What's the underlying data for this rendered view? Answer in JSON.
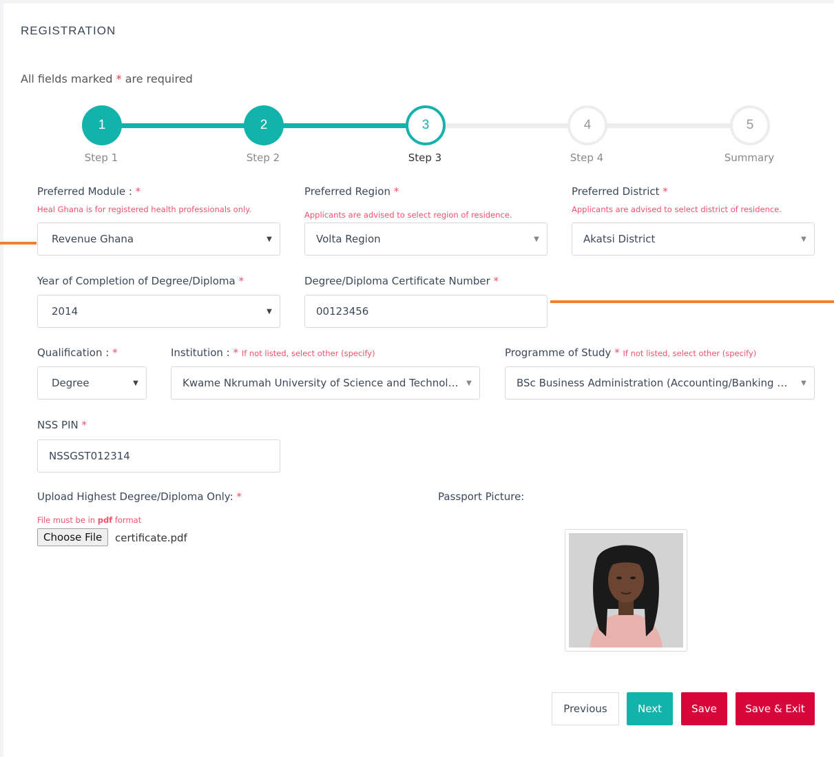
{
  "form": {
    "title": "REGISTRATION",
    "required_prefix": "All fields marked",
    "required_star": "*",
    "required_suffix": "are required"
  },
  "steps": [
    {
      "number": "1",
      "label": "Step 1",
      "state": "done"
    },
    {
      "number": "2",
      "label": "Step 2",
      "state": "done"
    },
    {
      "number": "3",
      "label": "Step 3",
      "state": "active"
    },
    {
      "number": "4",
      "label": "Step 4",
      "state": "todo"
    },
    {
      "number": "5",
      "label": "Summary",
      "state": "todo"
    }
  ],
  "fields": {
    "module": {
      "label": "Preferred Module :",
      "hint": "Heal Ghana is for registered health professionals only.",
      "value": "Revenue Ghana"
    },
    "region": {
      "label": "Preferred Region",
      "hint": "Applicants are advised to select region of residence.",
      "value": "Volta Region"
    },
    "district": {
      "label": "Preferred District",
      "hint": "Applicants are advised to select district of residence.",
      "value": "Akatsi District"
    },
    "year": {
      "label": "Year of Completion of Degree/Diploma",
      "value": "2014"
    },
    "certificate": {
      "label": "Degree/Diploma Certificate Number",
      "value": "00123456"
    },
    "qualification": {
      "label": "Qualification :",
      "value": "Degree"
    },
    "institution": {
      "label": "Institution :",
      "hint": "If not listed, select other (specify)",
      "value": "Kwame Nkrumah University of Science and Technology"
    },
    "programme": {
      "label": "Programme of Study",
      "hint": "If not listed, select other (specify)",
      "value": "BSc Business Administration (Accounting/Banking & Finance)"
    },
    "nss_pin": {
      "label": "NSS PIN",
      "value": "NSSGST012314"
    },
    "upload": {
      "label": "Upload Highest Degree/Diploma Only:",
      "hint_prefix": "File must be in",
      "hint_bold": "pdf",
      "hint_suffix": "format",
      "button": "Choose File",
      "filename": "certificate.pdf"
    },
    "passport": {
      "label": "Passport Picture:"
    }
  },
  "buttons": {
    "previous": "Previous",
    "next": "Next",
    "save": "Save",
    "save_exit": "Save & Exit"
  },
  "colors": {
    "accent": "#13b2aa",
    "danger": "#d6063b",
    "required": "#f0506e",
    "highlight": "#f07f33"
  }
}
